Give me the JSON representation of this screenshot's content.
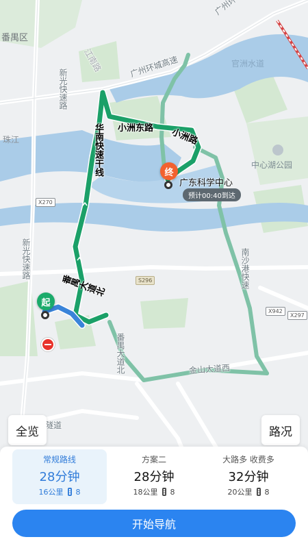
{
  "map": {
    "labels": {
      "panyu_district": "番禺区",
      "zhu_jiang": "珠江",
      "guanzhou_shuidao": "官洲水道",
      "xinguang_north": "新光快速路",
      "xinguang_south": "新光快速路",
      "huanzhou_east": "广州环城高速",
      "huanzhou_west": "广州环城高速",
      "suidao": "隧道",
      "jiangnan_road": "江南路",
      "huanan_expressway": "华南快速干线",
      "xiaozhou_east": "小洲东路",
      "xiaozhou_road": "小洲路",
      "panyu_avenue_north": "番禺大道北",
      "panyu_avenue_north_2": "番禺大道北",
      "nansha_expressway": "南沙港快速",
      "jinshan_avenue_west": "金山大道西",
      "center_lake_park": "中心湖公园"
    },
    "shields": {
      "x270": "X270",
      "s296": "S296",
      "x942": "X942",
      "x297": "X297"
    },
    "destination": {
      "name": "广东科学中心",
      "eta": "预计00:40到达"
    },
    "start_pin": "起",
    "end_pin": "终"
  },
  "buttons": {
    "overview": "全览",
    "traffic": "路况",
    "start_navigation": "开始导航"
  },
  "routes": [
    {
      "name": "常规路线",
      "time": "28分钟",
      "distance": "16公里",
      "lights": "8",
      "selected": true
    },
    {
      "name": "方案二",
      "time": "28分钟",
      "distance": "18公里",
      "lights": "8",
      "selected": false
    },
    {
      "name": "大路多 收费多",
      "time": "32分钟",
      "distance": "20公里",
      "lights": "8",
      "selected": false
    }
  ],
  "colors": {
    "route_green": "#1ba068",
    "route_blue": "#3a84d9",
    "alt_route": "#7fc2a7",
    "water": "#aacce8",
    "green_area": "#d4e8d2",
    "accent_blue": "#2b84f0"
  }
}
